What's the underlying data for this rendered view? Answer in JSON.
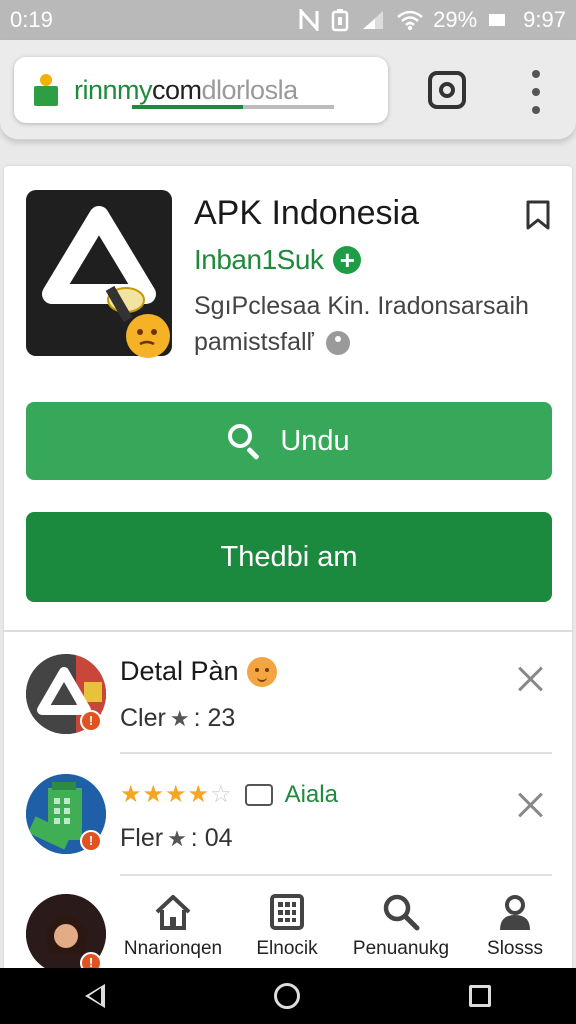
{
  "status_bar": {
    "time_left": "0:19",
    "battery": "29%",
    "time_right": "9:97"
  },
  "browser": {
    "url_part1": "rinnmy",
    "url_part2": "com",
    "url_part3": "dlorlosla",
    "load_progress": 0.55
  },
  "app": {
    "title": "APK Indonesia",
    "developer": "Inban1Suk",
    "description_line1": "SgıPclesaa Kin. Iradonsarsaih",
    "description_line2": "pamistsfalľ",
    "primary_button": "Undu",
    "secondary_button": "Thedbi am"
  },
  "list": [
    {
      "title": "Detal Pàn",
      "subtitle_prefix": "Cler",
      "subtitle_value": ": 23"
    },
    {
      "rating_stars": 4,
      "rating_label": "Aiala",
      "subtitle_prefix": "Fler",
      "subtitle_value": ": 04"
    }
  ],
  "bottom_nav": [
    {
      "label": "Nnarionqen",
      "icon": "home-icon"
    },
    {
      "label": "Elnocik",
      "icon": "grid-icon"
    },
    {
      "label": "Penuanukg",
      "icon": "search-icon"
    },
    {
      "label": "Slosss",
      "icon": "person-icon"
    }
  ],
  "colors": {
    "primary_green": "#37a85a",
    "dark_green": "#1c8a3e",
    "brand_green": "#1f8a3b",
    "star_orange": "#f5a623"
  }
}
